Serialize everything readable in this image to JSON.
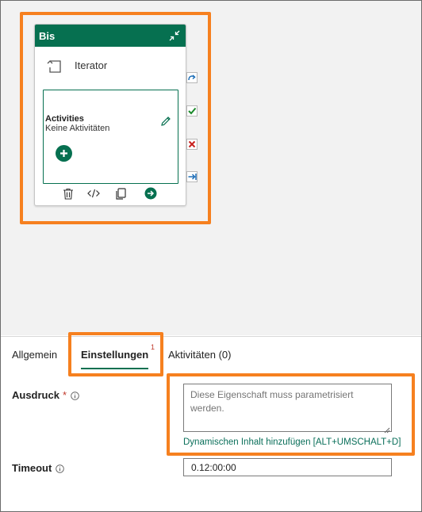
{
  "canvas": {
    "activity": {
      "title": "Bis",
      "type_label": "Iterator",
      "activities_title": "Activities",
      "activities_empty": "Keine Aktivitäten",
      "header_color": "#067050"
    },
    "ports": [
      "skip-icon",
      "success-check-icon",
      "failure-x-icon",
      "completion-arrow-icon"
    ],
    "toolbar_icons": [
      "delete-icon",
      "code-icon",
      "copy-icon",
      "go-arrow-icon"
    ]
  },
  "tabs": [
    {
      "label": "Allgemein"
    },
    {
      "label": "Einstellungen",
      "badge": "1",
      "active": true
    },
    {
      "label": "Aktivitäten (0)"
    }
  ],
  "form": {
    "expression": {
      "label": "Ausdruck",
      "required_mark": "*",
      "placeholder": "Diese Eigenschaft muss parametrisiert werden.",
      "dynamic_link": "Dynamischen Inhalt hinzufügen [ALT+UMSCHALT+D]"
    },
    "timeout": {
      "label": "Timeout",
      "value": "0.12:00:00"
    }
  },
  "colors": {
    "accent": "#067050",
    "highlight": "#f6801f",
    "required": "#c0392b"
  }
}
